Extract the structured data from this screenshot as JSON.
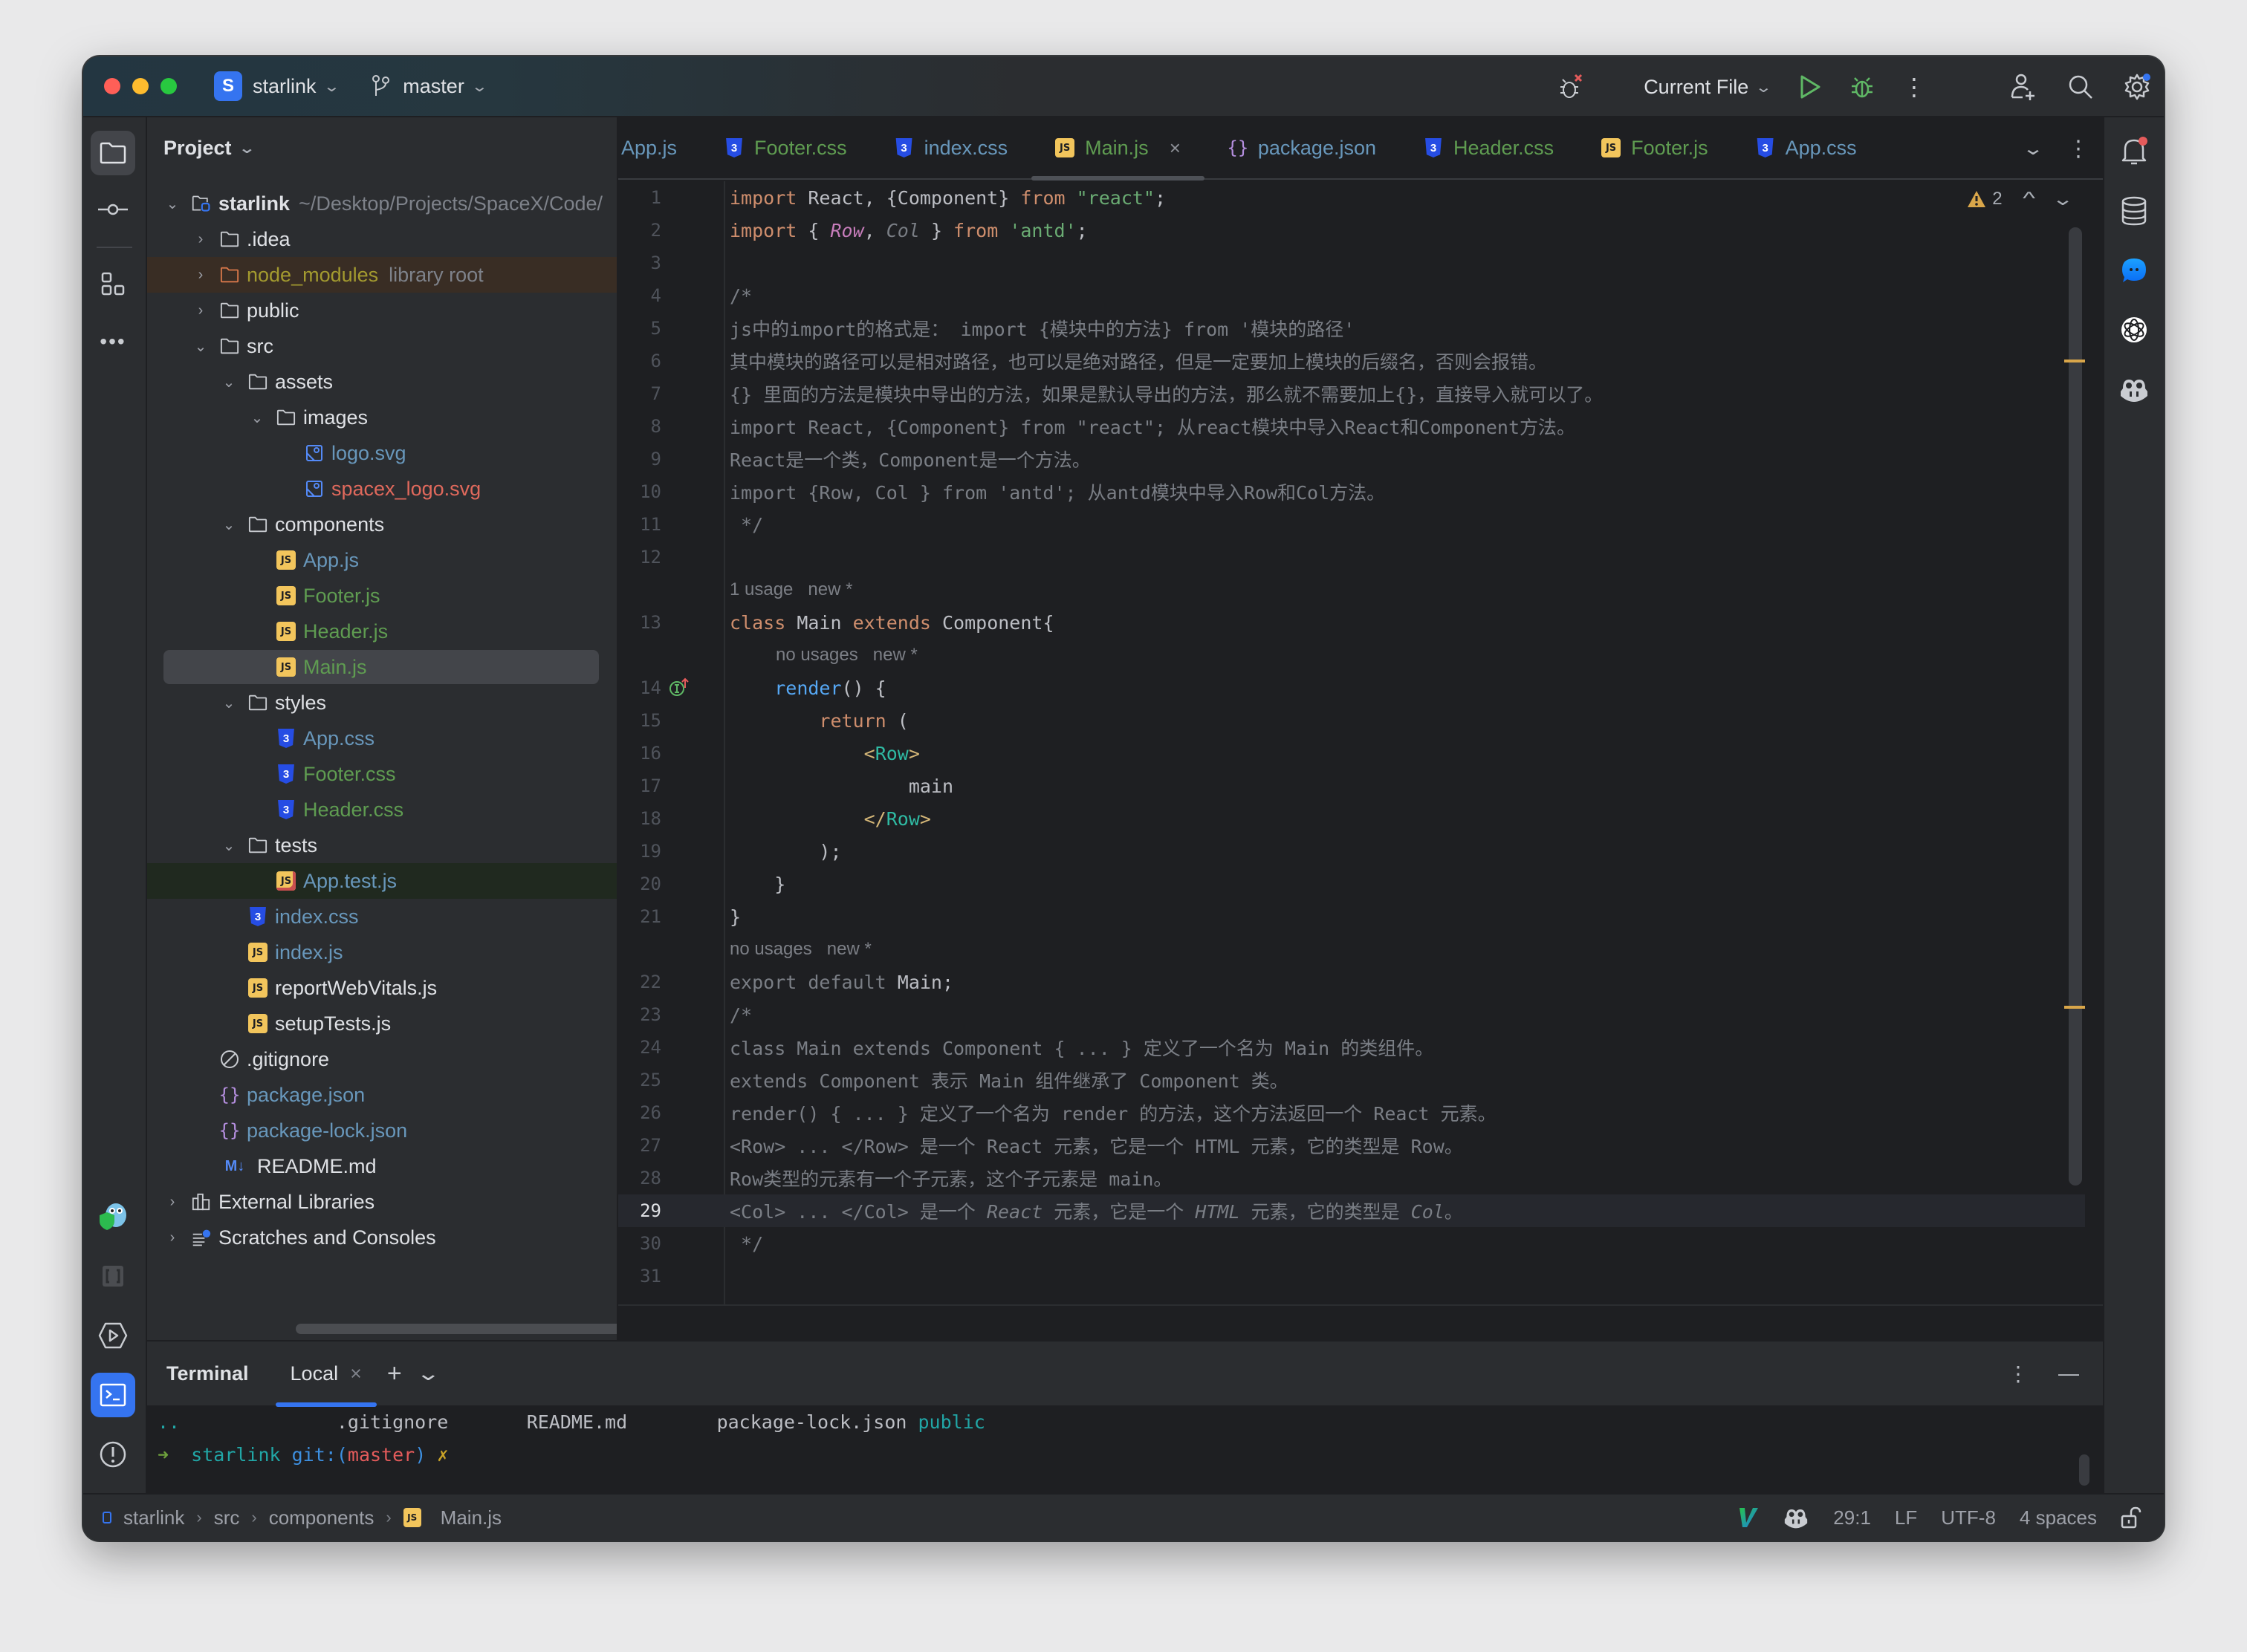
{
  "titlebar": {
    "project_initial": "S",
    "project_name": "starlink",
    "branch": "master",
    "run_config": "Current File"
  },
  "project_panel": {
    "title": "Project",
    "root_name": "starlink",
    "root_path": "~/Desktop/Projects/SpaceX/Code/",
    "tree": [
      {
        "label": ".idea",
        "suffix": "",
        "type": "folder",
        "depth": 1,
        "expanded": false,
        "color": "default"
      },
      {
        "label": "node_modules",
        "suffix": "library root",
        "type": "folder-lib",
        "depth": 1,
        "expanded": false,
        "color": "olive"
      },
      {
        "label": "public",
        "suffix": "",
        "type": "folder",
        "depth": 1,
        "expanded": false,
        "color": "default"
      },
      {
        "label": "src",
        "suffix": "",
        "type": "folder",
        "depth": 1,
        "expanded": true,
        "color": "default"
      },
      {
        "label": "assets",
        "suffix": "",
        "type": "folder",
        "depth": 2,
        "expanded": true,
        "color": "default"
      },
      {
        "label": "images",
        "suffix": "",
        "type": "folder",
        "depth": 3,
        "expanded": true,
        "color": "default"
      },
      {
        "label": "logo.svg",
        "suffix": "",
        "type": "svg",
        "depth": 4,
        "color": "blue"
      },
      {
        "label": "spacex_logo.svg",
        "suffix": "",
        "type": "svg",
        "depth": 4,
        "color": "red"
      },
      {
        "label": "components",
        "suffix": "",
        "type": "folder",
        "depth": 2,
        "expanded": true,
        "color": "default"
      },
      {
        "label": "App.js",
        "suffix": "",
        "type": "js",
        "depth": 3,
        "color": "blue"
      },
      {
        "label": "Footer.js",
        "suffix": "",
        "type": "js",
        "depth": 3,
        "color": "green"
      },
      {
        "label": "Header.js",
        "suffix": "",
        "type": "js",
        "depth": 3,
        "color": "green"
      },
      {
        "label": "Main.js",
        "suffix": "",
        "type": "js",
        "depth": 3,
        "color": "green",
        "selected": true
      },
      {
        "label": "styles",
        "suffix": "",
        "type": "folder",
        "depth": 2,
        "expanded": true,
        "color": "default"
      },
      {
        "label": "App.css",
        "suffix": "",
        "type": "css",
        "depth": 3,
        "color": "blue"
      },
      {
        "label": "Footer.css",
        "suffix": "",
        "type": "css",
        "depth": 3,
        "color": "green"
      },
      {
        "label": "Header.css",
        "suffix": "",
        "type": "css",
        "depth": 3,
        "color": "green"
      },
      {
        "label": "tests",
        "suffix": "",
        "type": "folder",
        "depth": 2,
        "expanded": true,
        "color": "default"
      },
      {
        "label": "App.test.js",
        "suffix": "",
        "type": "jstest",
        "depth": 3,
        "color": "blue",
        "test": true
      },
      {
        "label": "index.css",
        "suffix": "",
        "type": "css",
        "depth": 2,
        "color": "blue"
      },
      {
        "label": "index.js",
        "suffix": "",
        "type": "js",
        "depth": 2,
        "color": "blue"
      },
      {
        "label": "reportWebVitals.js",
        "suffix": "",
        "type": "js",
        "depth": 2,
        "color": "default"
      },
      {
        "label": "setupTests.js",
        "suffix": "",
        "type": "js",
        "depth": 2,
        "color": "default"
      },
      {
        "label": ".gitignore",
        "suffix": "",
        "type": "ignore",
        "depth": 1,
        "color": "default"
      },
      {
        "label": "package.json",
        "suffix": "",
        "type": "json",
        "depth": 1,
        "color": "blue"
      },
      {
        "label": "package-lock.json",
        "suffix": "",
        "type": "json",
        "depth": 1,
        "color": "blue"
      },
      {
        "label": "README.md",
        "suffix": "",
        "type": "md",
        "depth": 1,
        "color": "default"
      },
      {
        "label": "External Libraries",
        "suffix": "",
        "type": "extlib",
        "depth": 0,
        "expanded": false,
        "color": "default"
      },
      {
        "label": "Scratches and Consoles",
        "suffix": "",
        "type": "scratch",
        "depth": 0,
        "expanded": false,
        "color": "default"
      }
    ]
  },
  "editor": {
    "tabs": [
      {
        "label": "App.js",
        "type": "js",
        "color": "blue",
        "clipped": true
      },
      {
        "label": "Footer.css",
        "type": "css",
        "color": "green"
      },
      {
        "label": "index.css",
        "type": "css",
        "color": "blue"
      },
      {
        "label": "Main.js",
        "type": "js",
        "color": "green",
        "active": true
      },
      {
        "label": "package.json",
        "type": "json",
        "color": "blue"
      },
      {
        "label": "Header.css",
        "type": "css",
        "color": "green"
      },
      {
        "label": "Footer.js",
        "type": "js",
        "color": "green"
      },
      {
        "label": "App.css",
        "type": "css",
        "color": "blue"
      }
    ],
    "warning_count": "2",
    "current_line": 29,
    "lines": [
      {
        "n": "1",
        "parts": [
          [
            "kw",
            "import"
          ],
          [
            "pl",
            " React, {Component} "
          ],
          [
            "kw",
            "from"
          ],
          [
            "pl",
            " "
          ],
          [
            "str",
            "\"react\""
          ],
          [
            "pl",
            ";"
          ]
        ]
      },
      {
        "n": "2",
        "parts": [
          [
            "kw",
            "import"
          ],
          [
            "pl",
            " { "
          ],
          [
            "row-it",
            "Row"
          ],
          [
            "pl",
            ", "
          ],
          [
            "col-it",
            "Col"
          ],
          [
            "pl",
            " } "
          ],
          [
            "kw",
            "from"
          ],
          [
            "pl",
            " "
          ],
          [
            "str",
            "'antd'"
          ],
          [
            "pl",
            ";"
          ]
        ]
      },
      {
        "n": "3",
        "parts": []
      },
      {
        "n": "4",
        "parts": [
          [
            "cm",
            "/*"
          ]
        ]
      },
      {
        "n": "5",
        "parts": [
          [
            "cm",
            "js中的import的格式是： import {模块中的方法} from '模块的路径'"
          ]
        ]
      },
      {
        "n": "6",
        "parts": [
          [
            "cm",
            "其中模块的路径可以是相对路径，也可以是绝对路径，但是一定要加上模块的后缀名，否则会报错。"
          ]
        ]
      },
      {
        "n": "7",
        "parts": [
          [
            "cm",
            "{} 里面的方法是模块中导出的方法，如果是默认导出的方法，那么就不需要加上{}，直接导入就可以了。"
          ]
        ]
      },
      {
        "n": "8",
        "parts": [
          [
            "cm",
            "import React, {Component} from \"react\"; 从react模块中导入React和Component方法。"
          ]
        ]
      },
      {
        "n": "9",
        "parts": [
          [
            "cm",
            "React是一个类，Component是一个方法。"
          ]
        ]
      },
      {
        "n": "10",
        "parts": [
          [
            "cm",
            "import {Row, Col } from 'antd'; 从antd模块中导入Row和Col方法。"
          ]
        ]
      },
      {
        "n": "11",
        "parts": [
          [
            "cm",
            " */"
          ]
        ]
      },
      {
        "n": "12",
        "parts": []
      },
      {
        "hint": "1 usage   new *",
        "indent": 0
      },
      {
        "n": "13",
        "parts": [
          [
            "kw",
            "class"
          ],
          [
            "pl",
            " Main "
          ],
          [
            "kw",
            "extends"
          ],
          [
            "pl",
            " Component{"
          ]
        ]
      },
      {
        "hint": "no usages   new *",
        "indent": 1
      },
      {
        "n": "14",
        "gutter_icon": true,
        "parts": [
          [
            "pl",
            "    "
          ],
          [
            "fn",
            "render"
          ],
          [
            "pl",
            "() {"
          ]
        ]
      },
      {
        "n": "15",
        "parts": [
          [
            "pl",
            "        "
          ],
          [
            "kw",
            "return"
          ],
          [
            "pl",
            " ("
          ]
        ]
      },
      {
        "n": "16",
        "parts": [
          [
            "pl",
            "            "
          ],
          [
            "brk",
            "<"
          ],
          [
            "tag",
            "Row"
          ],
          [
            "brk",
            ">"
          ]
        ]
      },
      {
        "n": "17",
        "parts": [
          [
            "pl",
            "                main"
          ]
        ]
      },
      {
        "n": "18",
        "parts": [
          [
            "pl",
            "            "
          ],
          [
            "brk",
            "</"
          ],
          [
            "tag",
            "Row"
          ],
          [
            "brk",
            ">"
          ]
        ]
      },
      {
        "n": "19",
        "parts": [
          [
            "pl",
            "        );"
          ]
        ]
      },
      {
        "n": "20",
        "parts": [
          [
            "pl",
            "    }"
          ]
        ]
      },
      {
        "n": "21",
        "parts": [
          [
            "pl",
            "}"
          ]
        ]
      },
      {
        "hint": "no usages   new *",
        "indent": 0
      },
      {
        "n": "22",
        "parts": [
          [
            "cm",
            "export default "
          ],
          [
            "pl",
            "Main;"
          ]
        ]
      },
      {
        "n": "23",
        "parts": [
          [
            "cm",
            "/*"
          ]
        ]
      },
      {
        "n": "24",
        "parts": [
          [
            "cm",
            "class Main extends Component { ... } 定义了一个名为 Main 的类组件。"
          ]
        ]
      },
      {
        "n": "25",
        "parts": [
          [
            "cm",
            "extends Component 表示 Main 组件继承了 Component 类。"
          ]
        ]
      },
      {
        "n": "26",
        "parts": [
          [
            "cm",
            "render() { ... } 定义了一个名为 render 的方法，这个方法返回一个 React 元素。"
          ]
        ]
      },
      {
        "n": "27",
        "parts": [
          [
            "cm",
            "<Row> ... </Row> 是一个 React 元素，它是一个 HTML 元素，它的类型是 Row。"
          ]
        ]
      },
      {
        "n": "28",
        "parts": [
          [
            "cm",
            "Row类型的元素有一个子元素，这个子元素是 main。"
          ]
        ]
      },
      {
        "n": "29",
        "parts": [
          [
            "cm",
            "<Col> ... </Col> 是一个 "
          ],
          [
            "cm-i",
            "React"
          ],
          [
            "cm",
            " 元素，它是一个 "
          ],
          [
            "cm-i",
            "HTML"
          ],
          [
            "cm",
            " 元素，它的类型是 "
          ],
          [
            "cm-i",
            "Col"
          ],
          [
            "cm",
            "。"
          ]
        ]
      },
      {
        "n": "30",
        "parts": [
          [
            "cm",
            " */"
          ]
        ]
      },
      {
        "n": "31",
        "parts": []
      }
    ]
  },
  "terminal": {
    "title": "Terminal",
    "tab_label": "Local",
    "listing": [
      [
        "t-cyan",
        ".."
      ],
      [
        "t-plain",
        "              .gitignore       README.md        package-lock.json "
      ],
      [
        "t-cyan",
        "public"
      ]
    ],
    "prompt": [
      [
        "t-greenc",
        "➜ "
      ],
      [
        "t-cyan",
        " starlink "
      ],
      [
        "t-blue",
        "git:("
      ],
      [
        "t-redc",
        "master"
      ],
      [
        "t-blue",
        ")"
      ],
      [
        "t-yelc",
        " ✗"
      ]
    ]
  },
  "statusbar": {
    "breadcrumb": [
      "starlink",
      "src",
      "components",
      "Main.js"
    ],
    "position": "29:1",
    "line_ending": "LF",
    "encoding": "UTF-8",
    "indent": "4 spaces"
  },
  "colors": {
    "accent": "#3574f0",
    "background": "#1e1f22",
    "panel": "#2b2d30",
    "keyword": "#cf8e6d",
    "string": "#6aab73",
    "comment": "#7a7e85",
    "vcs_modified": "#6897bb",
    "vcs_added": "#5f9c51",
    "vcs_unversioned": "#e0695c"
  }
}
